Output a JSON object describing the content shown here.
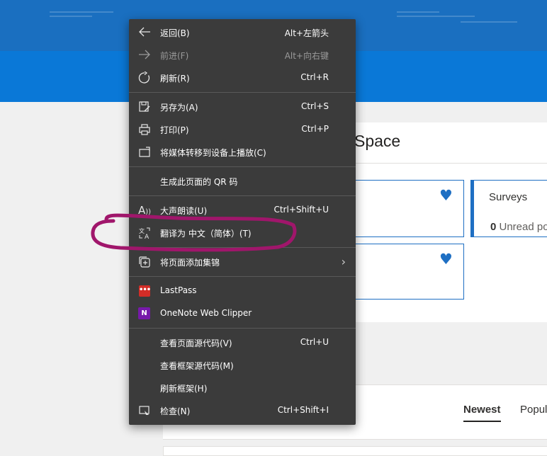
{
  "background": {
    "page_title": "Space",
    "cards": [
      {
        "title": "Surveys",
        "subtitle_count": "0",
        "subtitle_text": " Unread po"
      }
    ],
    "tabs": [
      "Newest",
      "Popul"
    ]
  },
  "menu": {
    "items": [
      {
        "label": "返回(B)",
        "shortcut": "Alt+左箭头",
        "icon": "back-arrow-icon"
      },
      {
        "label": "前进(F)",
        "shortcut": "Alt+向右键",
        "icon": "forward-arrow-icon",
        "disabled": true
      },
      {
        "label": "刷新(R)",
        "shortcut": "Ctrl+R",
        "icon": "refresh-icon"
      },
      {
        "label": "另存为(A)",
        "shortcut": "Ctrl+S",
        "icon": "save-as-icon"
      },
      {
        "label": "打印(P)",
        "shortcut": "Ctrl+P",
        "icon": "print-icon"
      },
      {
        "label": "将媒体转移到设备上播放(C)",
        "shortcut": "",
        "icon": "cast-icon"
      },
      {
        "label": "生成此页面的 QR 码",
        "shortcut": ""
      },
      {
        "label": "大声朗读(U)",
        "shortcut": "Ctrl+Shift+U",
        "icon": "read-aloud-icon"
      },
      {
        "label": "翻译为 中文（简体）(T)",
        "shortcut": "",
        "icon": "translate-icon"
      },
      {
        "label": "将页面添加集锦",
        "shortcut": "",
        "icon": "collections-icon"
      },
      {
        "label": "LastPass",
        "shortcut": "",
        "icon": "lastpass-icon",
        "icon_text": "•••"
      },
      {
        "label": "OneNote Web Clipper",
        "shortcut": "",
        "icon": "onenote-icon",
        "icon_text": "N"
      },
      {
        "label": "查看页面源代码(V)",
        "shortcut": "Ctrl+U"
      },
      {
        "label": "查看框架源代码(M)",
        "shortcut": ""
      },
      {
        "label": "刷新框架(H)",
        "shortcut": ""
      },
      {
        "label": "检查(N)",
        "shortcut": "Ctrl+Shift+I",
        "icon": "inspect-icon"
      }
    ]
  },
  "colors": {
    "top_band": "#1a6fc0",
    "blue_band": "#0a78d7",
    "menu_bg": "#3b3b3b",
    "annotation": "#a0166b",
    "accent": "#1e6fc3"
  }
}
